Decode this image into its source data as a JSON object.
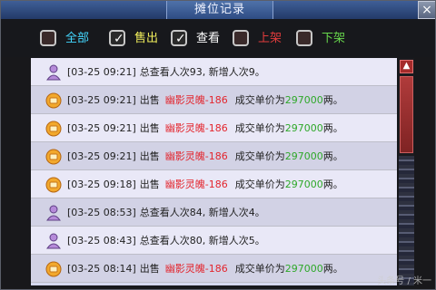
{
  "window": {
    "title": "摊位记录",
    "close_label": "×"
  },
  "filters": [
    {
      "label": "全部",
      "checked": false,
      "color": "#43d7ff"
    },
    {
      "label": "售出",
      "checked": true,
      "color": "#f2f05c"
    },
    {
      "label": "查看",
      "checked": true,
      "color": "#ffffff"
    },
    {
      "label": "上架",
      "checked": false,
      "color": "#e23c3c"
    },
    {
      "label": "下架",
      "checked": false,
      "color": "#67d64c"
    }
  ],
  "records": [
    {
      "type": "view",
      "icon": "purple-person-icon",
      "time": "[03-25 09:21]",
      "text": "总查看人次93, 新增人次9。"
    },
    {
      "type": "sale",
      "icon": "orange-coin-icon",
      "time": "[03-25 09:21]",
      "action": "出售",
      "item": "幽影灵魄-186",
      "price_prefix": "成交单价为",
      "price": "297000",
      "price_suffix": "两。"
    },
    {
      "type": "sale",
      "icon": "orange-coin-icon",
      "time": "[03-25 09:21]",
      "action": "出售",
      "item": "幽影灵魄-186",
      "price_prefix": "成交单价为",
      "price": "297000",
      "price_suffix": "两。"
    },
    {
      "type": "sale",
      "icon": "orange-coin-icon",
      "time": "[03-25 09:21]",
      "action": "出售",
      "item": "幽影灵魄-186",
      "price_prefix": "成交单价为",
      "price": "297000",
      "price_suffix": "两。"
    },
    {
      "type": "sale",
      "icon": "orange-coin-icon",
      "time": "[03-25 09:18]",
      "action": "出售",
      "item": "幽影灵魄-186",
      "price_prefix": "成交单价为",
      "price": "297000",
      "price_suffix": "两。"
    },
    {
      "type": "view",
      "icon": "purple-person-icon",
      "time": "[03-25 08:53]",
      "text": "总查看人次84, 新增人次4。"
    },
    {
      "type": "view",
      "icon": "purple-person-icon",
      "time": "[03-25 08:43]",
      "text": "总查看人次80, 新增人次5。"
    },
    {
      "type": "sale",
      "icon": "orange-coin-icon",
      "time": "[03-25 08:14]",
      "action": "出售",
      "item": "幽影灵魄-186",
      "price_prefix": "成交单价为",
      "price": "297000",
      "price_suffix": "两。"
    }
  ],
  "watermark": "头条号 / 米一"
}
